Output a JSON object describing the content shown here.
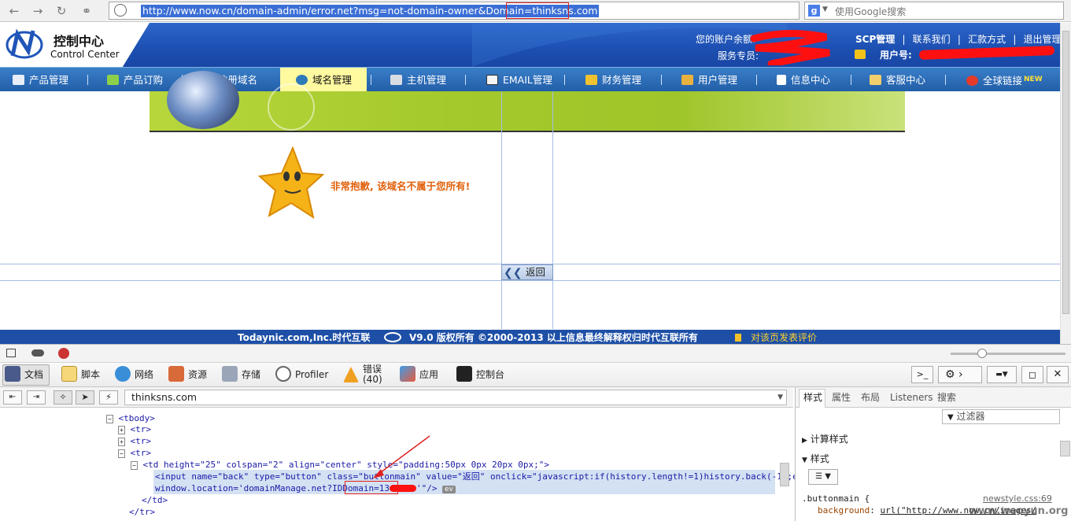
{
  "browser": {
    "url": "http://www.now.cn/domain-admin/error.net?msg=not-domain-owner&Domain=thinksns.com",
    "search_placeholder": "使用Google搜索"
  },
  "header": {
    "logo_title": "控制中心",
    "logo_subtitle": "Control Center",
    "balance_label": "您的账户余额:",
    "service_label": "服务专员:",
    "links": [
      "SCP管理",
      "联系我们",
      "汇款方式",
      "退出管理"
    ],
    "user_label": "用户号:"
  },
  "nav": {
    "items": [
      "产品管理",
      "产品订购",
      "注册域名",
      "域名管理",
      "主机管理",
      "EMAIL管理",
      "财务管理",
      "用户管理",
      "信息中心",
      "客服中心",
      "全球链接"
    ],
    "active": "域名管理",
    "new_badge": "NEW"
  },
  "main": {
    "error_message": "非常抱歉, 该域名不属于您所有!",
    "back_button": "返回"
  },
  "footer": {
    "text": "Todaynic.com,Inc.时代互联",
    "version": "V9.0 版权所有 ©2000-2013 以上信息最终解释权归时代互联所有",
    "feedback_link": "对该页发表评价"
  },
  "devtools": {
    "tabs": [
      {
        "label": "文档",
        "icon": "document-icon"
      },
      {
        "label": "脚本",
        "icon": "script-icon"
      },
      {
        "label": "网络",
        "icon": "network-icon"
      },
      {
        "label": "资源",
        "icon": "resources-icon"
      },
      {
        "label": "存储",
        "icon": "storage-icon"
      },
      {
        "label": "Profiler",
        "icon": "profiler-icon"
      },
      {
        "label": "错误",
        "icon": "error-icon"
      },
      {
        "label": "应用",
        "icon": "apps-icon"
      },
      {
        "label": "控制台",
        "icon": "console-icon"
      }
    ],
    "error_count": "(40)",
    "breadcrumb": "thinksns.com",
    "side_tabs": [
      "样式",
      "属性",
      "布局",
      "Listeners",
      "搜索"
    ],
    "filter_placeholder": "过滤器",
    "computed_label": "计算样式",
    "styles_label": "样式",
    "css_selector": ".buttonmain {",
    "css_source": "newstyle.css:69",
    "css_prop": "background",
    "css_value": "url(\"http://www.now.cn/images/",
    "ev_badge": "ev",
    "code": {
      "tbody": "<tbody>",
      "tr": "<tr>",
      "td_open": "<td height=\"25\" colspan=\"2\" align=\"center\" style=\"padding:50px 0px 20px 0px;\">",
      "input_line1": "<input name=\"back\" type=\"button\" class=\"buttonmain\" value=\"返回\" onclick=\"javascript:if(history.length!=1)history.back(-1);else",
      "input_line2": "window.location='domainManage.net?IDDomain=13",
      "input_line2_end": "'\"/>",
      "td_close": "</td>",
      "tr_close": "</tr>"
    }
  },
  "watermark": "www.weoyun.org"
}
